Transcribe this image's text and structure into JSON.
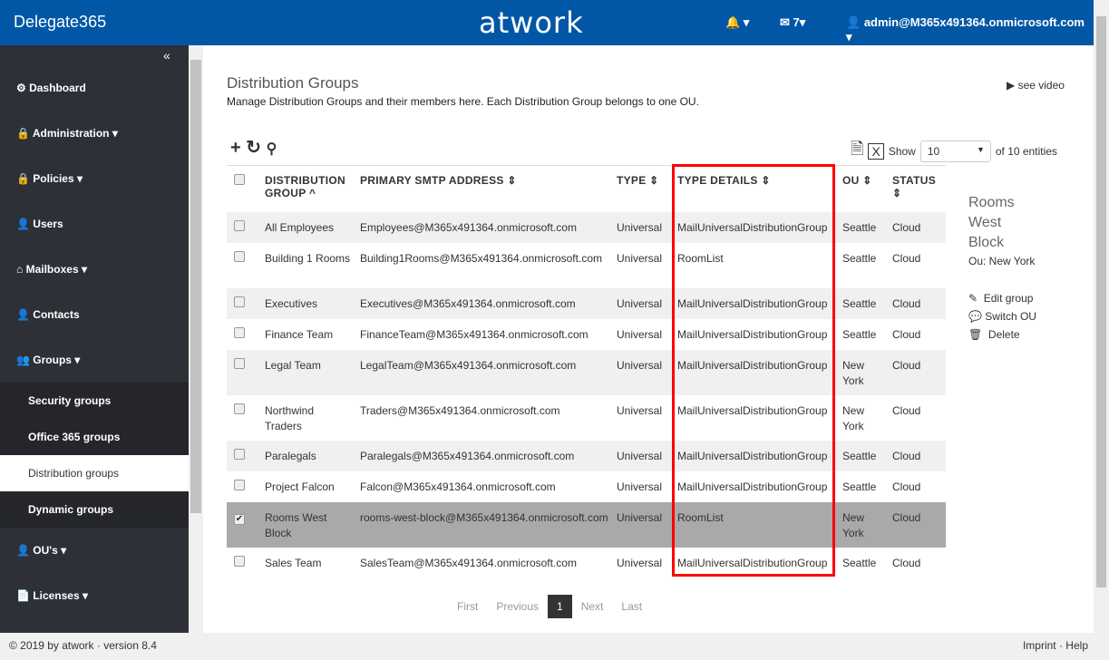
{
  "header": {
    "brand": "Delegate365",
    "logo": "atwork",
    "mail_count": "7",
    "user": "admin@M365x491364.onmicrosoft.com"
  },
  "sidebar": {
    "collapse": "«",
    "items": [
      "Dashboard",
      "Administration",
      "Policies",
      "Users",
      "Mailboxes",
      "Contacts",
      "Groups"
    ],
    "sub": [
      "Security groups",
      "Office 365 groups",
      "Distribution groups",
      "Dynamic groups"
    ],
    "items2": [
      "OU's",
      "Licenses"
    ]
  },
  "page": {
    "title": "Distribution Groups",
    "description": "Manage Distribution Groups and their members here. Each Distribution Group belongs to one OU.",
    "video": "see video",
    "show": "Show",
    "page_size": "10",
    "of_entities": "of 10 entities"
  },
  "columns": [
    "DISTRIBUTION GROUP",
    "PRIMARY SMTP ADDRESS",
    "TYPE",
    "TYPE DETAILS",
    "OU",
    "STATUS"
  ],
  "rows": [
    {
      "name": "All Employees",
      "smtp": "Employees@M365x491364.onmicrosoft.com",
      "type": "Universal",
      "details": "MailUniversalDistributionGroup",
      "ou": "Seattle",
      "status": "Cloud"
    },
    {
      "name": "Building 1 Rooms",
      "smtp": "Building1Rooms@M365x491364.onmicrosoft.com",
      "type": "Universal",
      "details": "RoomList",
      "ou": "Seattle",
      "status": "Cloud"
    },
    {
      "name": "Executives",
      "smtp": "Executives@M365x491364.onmicrosoft.com",
      "type": "Universal",
      "details": "MailUniversalDistributionGroup",
      "ou": "Seattle",
      "status": "Cloud"
    },
    {
      "name": "Finance Team",
      "smtp": "FinanceTeam@M365x491364.onmicrosoft.com",
      "type": "Universal",
      "details": "MailUniversalDistributionGroup",
      "ou": "Seattle",
      "status": "Cloud"
    },
    {
      "name": "Legal Team",
      "smtp": "LegalTeam@M365x491364.onmicrosoft.com",
      "type": "Universal",
      "details": "MailUniversalDistributionGroup",
      "ou": "New York",
      "status": "Cloud"
    },
    {
      "name": "Northwind Traders",
      "smtp": "Traders@M365x491364.onmicrosoft.com",
      "type": "Universal",
      "details": "MailUniversalDistributionGroup",
      "ou": "New York",
      "status": "Cloud"
    },
    {
      "name": "Paralegals",
      "smtp": "Paralegals@M365x491364.onmicrosoft.com",
      "type": "Universal",
      "details": "MailUniversalDistributionGroup",
      "ou": "Seattle",
      "status": "Cloud"
    },
    {
      "name": "Project Falcon",
      "smtp": "Falcon@M365x491364.onmicrosoft.com",
      "type": "Universal",
      "details": "MailUniversalDistributionGroup",
      "ou": "Seattle",
      "status": "Cloud"
    },
    {
      "name": "Rooms West Block",
      "smtp": "rooms-west-block@M365x491364.onmicrosoft.com",
      "type": "Universal",
      "details": "RoomList",
      "ou": "New York",
      "status": "Cloud",
      "selected": true
    },
    {
      "name": "Sales Team",
      "smtp": "SalesTeam@M365x491364.onmicrosoft.com",
      "type": "Universal",
      "details": "MailUniversalDistributionGroup",
      "ou": "Seattle",
      "status": "Cloud"
    }
  ],
  "detail": {
    "name": "Rooms West Block",
    "ou": "Ou: New York",
    "actions": [
      "Edit group",
      "Switch OU",
      "Delete"
    ]
  },
  "pagination": {
    "first": "First",
    "previous": "Previous",
    "current": "1",
    "next": "Next",
    "last": "Last"
  },
  "footer": {
    "left": "© 2019 by atwork · version 8.4",
    "right": "Imprint · Help"
  }
}
